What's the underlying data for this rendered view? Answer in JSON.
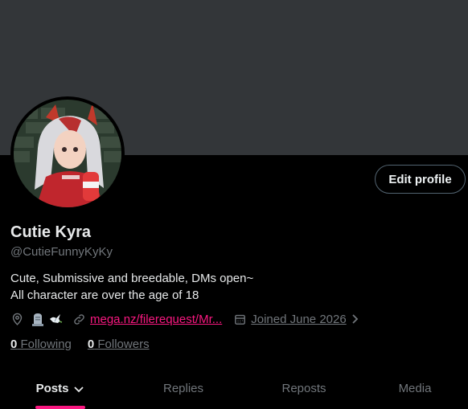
{
  "profile": {
    "display_name": "Cutie Kyra",
    "handle": "@CutieFunnyKyKy",
    "bio_line1": "Cute, Submissive and breedable, DMs open~",
    "bio_line2": "All character are over the age of 18",
    "link": "mega.nz/filerequest/Mr...",
    "joined": "Joined June 2026",
    "following_count": "0",
    "following_label": " Following",
    "followers_count": "0",
    "followers_label": " Followers"
  },
  "actions": {
    "edit_profile_label": "Edit profile"
  },
  "tabs": [
    {
      "label": "Posts",
      "active": true
    },
    {
      "label": "Replies",
      "active": false
    },
    {
      "label": "Reposts",
      "active": false
    },
    {
      "label": "Media",
      "active": false
    }
  ],
  "icons": {
    "location": "location-pin-icon",
    "emoji1": "tombstone-emoji-icon",
    "emoji2": "dove-emoji-icon",
    "link": "link-icon",
    "calendar": "calendar-icon",
    "chevron": "chevron-right-icon",
    "caret": "chevron-down-icon"
  },
  "colors": {
    "banner": "#333639",
    "background": "#000000",
    "accent": "#f91880",
    "muted": "#71767b",
    "text": "#e7e9ea"
  }
}
